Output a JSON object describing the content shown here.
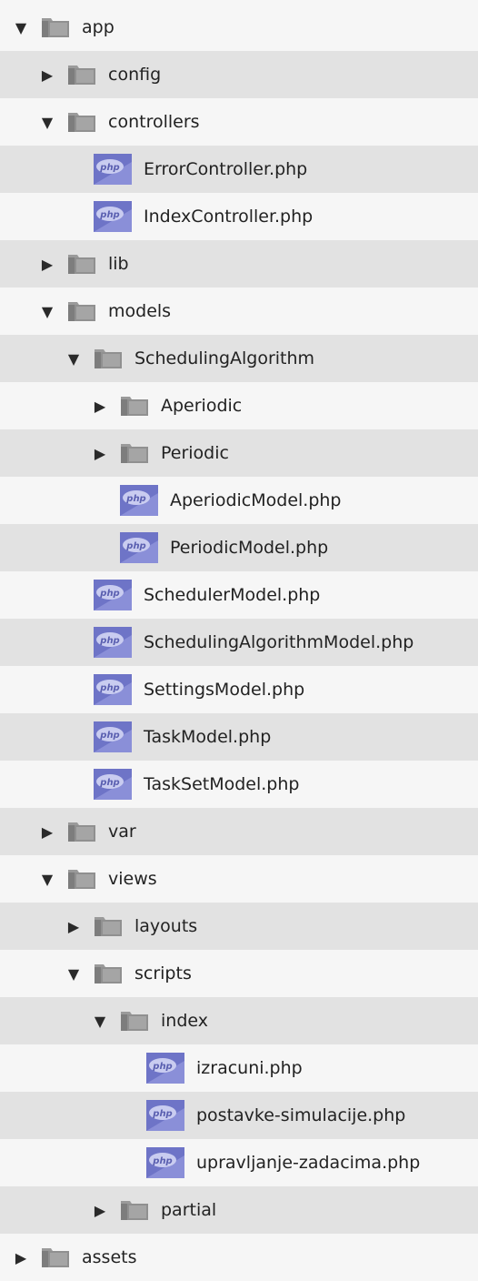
{
  "tree": {
    "items": [
      {
        "label": "app",
        "kind": "folder",
        "depth": 0,
        "state": "expanded"
      },
      {
        "label": "config",
        "kind": "folder",
        "depth": 1,
        "state": "collapsed"
      },
      {
        "label": "controllers",
        "kind": "folder",
        "depth": 1,
        "state": "expanded"
      },
      {
        "label": "ErrorController.php",
        "kind": "php",
        "depth": 2
      },
      {
        "label": "IndexController.php",
        "kind": "php",
        "depth": 2
      },
      {
        "label": "lib",
        "kind": "folder",
        "depth": 1,
        "state": "collapsed"
      },
      {
        "label": "models",
        "kind": "folder",
        "depth": 1,
        "state": "expanded"
      },
      {
        "label": "SchedulingAlgorithm",
        "kind": "folder",
        "depth": 2,
        "state": "expanded"
      },
      {
        "label": "Aperiodic",
        "kind": "folder",
        "depth": 3,
        "state": "collapsed"
      },
      {
        "label": "Periodic",
        "kind": "folder",
        "depth": 3,
        "state": "collapsed"
      },
      {
        "label": "AperiodicModel.php",
        "kind": "php",
        "depth": 3
      },
      {
        "label": "PeriodicModel.php",
        "kind": "php",
        "depth": 3
      },
      {
        "label": "SchedulerModel.php",
        "kind": "php",
        "depth": 2
      },
      {
        "label": "SchedulingAlgorithmModel.php",
        "kind": "php",
        "depth": 2
      },
      {
        "label": "SettingsModel.php",
        "kind": "php",
        "depth": 2
      },
      {
        "label": "TaskModel.php",
        "kind": "php",
        "depth": 2
      },
      {
        "label": "TaskSetModel.php",
        "kind": "php",
        "depth": 2
      },
      {
        "label": "var",
        "kind": "folder",
        "depth": 1,
        "state": "collapsed"
      },
      {
        "label": "views",
        "kind": "folder",
        "depth": 1,
        "state": "expanded"
      },
      {
        "label": "layouts",
        "kind": "folder",
        "depth": 2,
        "state": "collapsed"
      },
      {
        "label": "scripts",
        "kind": "folder",
        "depth": 2,
        "state": "expanded"
      },
      {
        "label": "index",
        "kind": "folder",
        "depth": 3,
        "state": "expanded"
      },
      {
        "label": "izracuni.php",
        "kind": "php",
        "depth": 4
      },
      {
        "label": "postavke-simulacije.php",
        "kind": "php",
        "depth": 4
      },
      {
        "label": "upravljanje-zadacima.php",
        "kind": "php",
        "depth": 4
      },
      {
        "label": "partial",
        "kind": "folder",
        "depth": 3,
        "state": "collapsed"
      },
      {
        "label": "assets",
        "kind": "folder",
        "depth": 0,
        "state": "collapsed"
      }
    ],
    "glyphs": {
      "expanded": "▼",
      "collapsed": "▶"
    },
    "php_badge": "php",
    "colors": {
      "row_light": "#f6f6f6",
      "row_dark": "#e2e2e2",
      "folder": "#8c8c8c",
      "php_bg": "#6e74c7"
    }
  }
}
